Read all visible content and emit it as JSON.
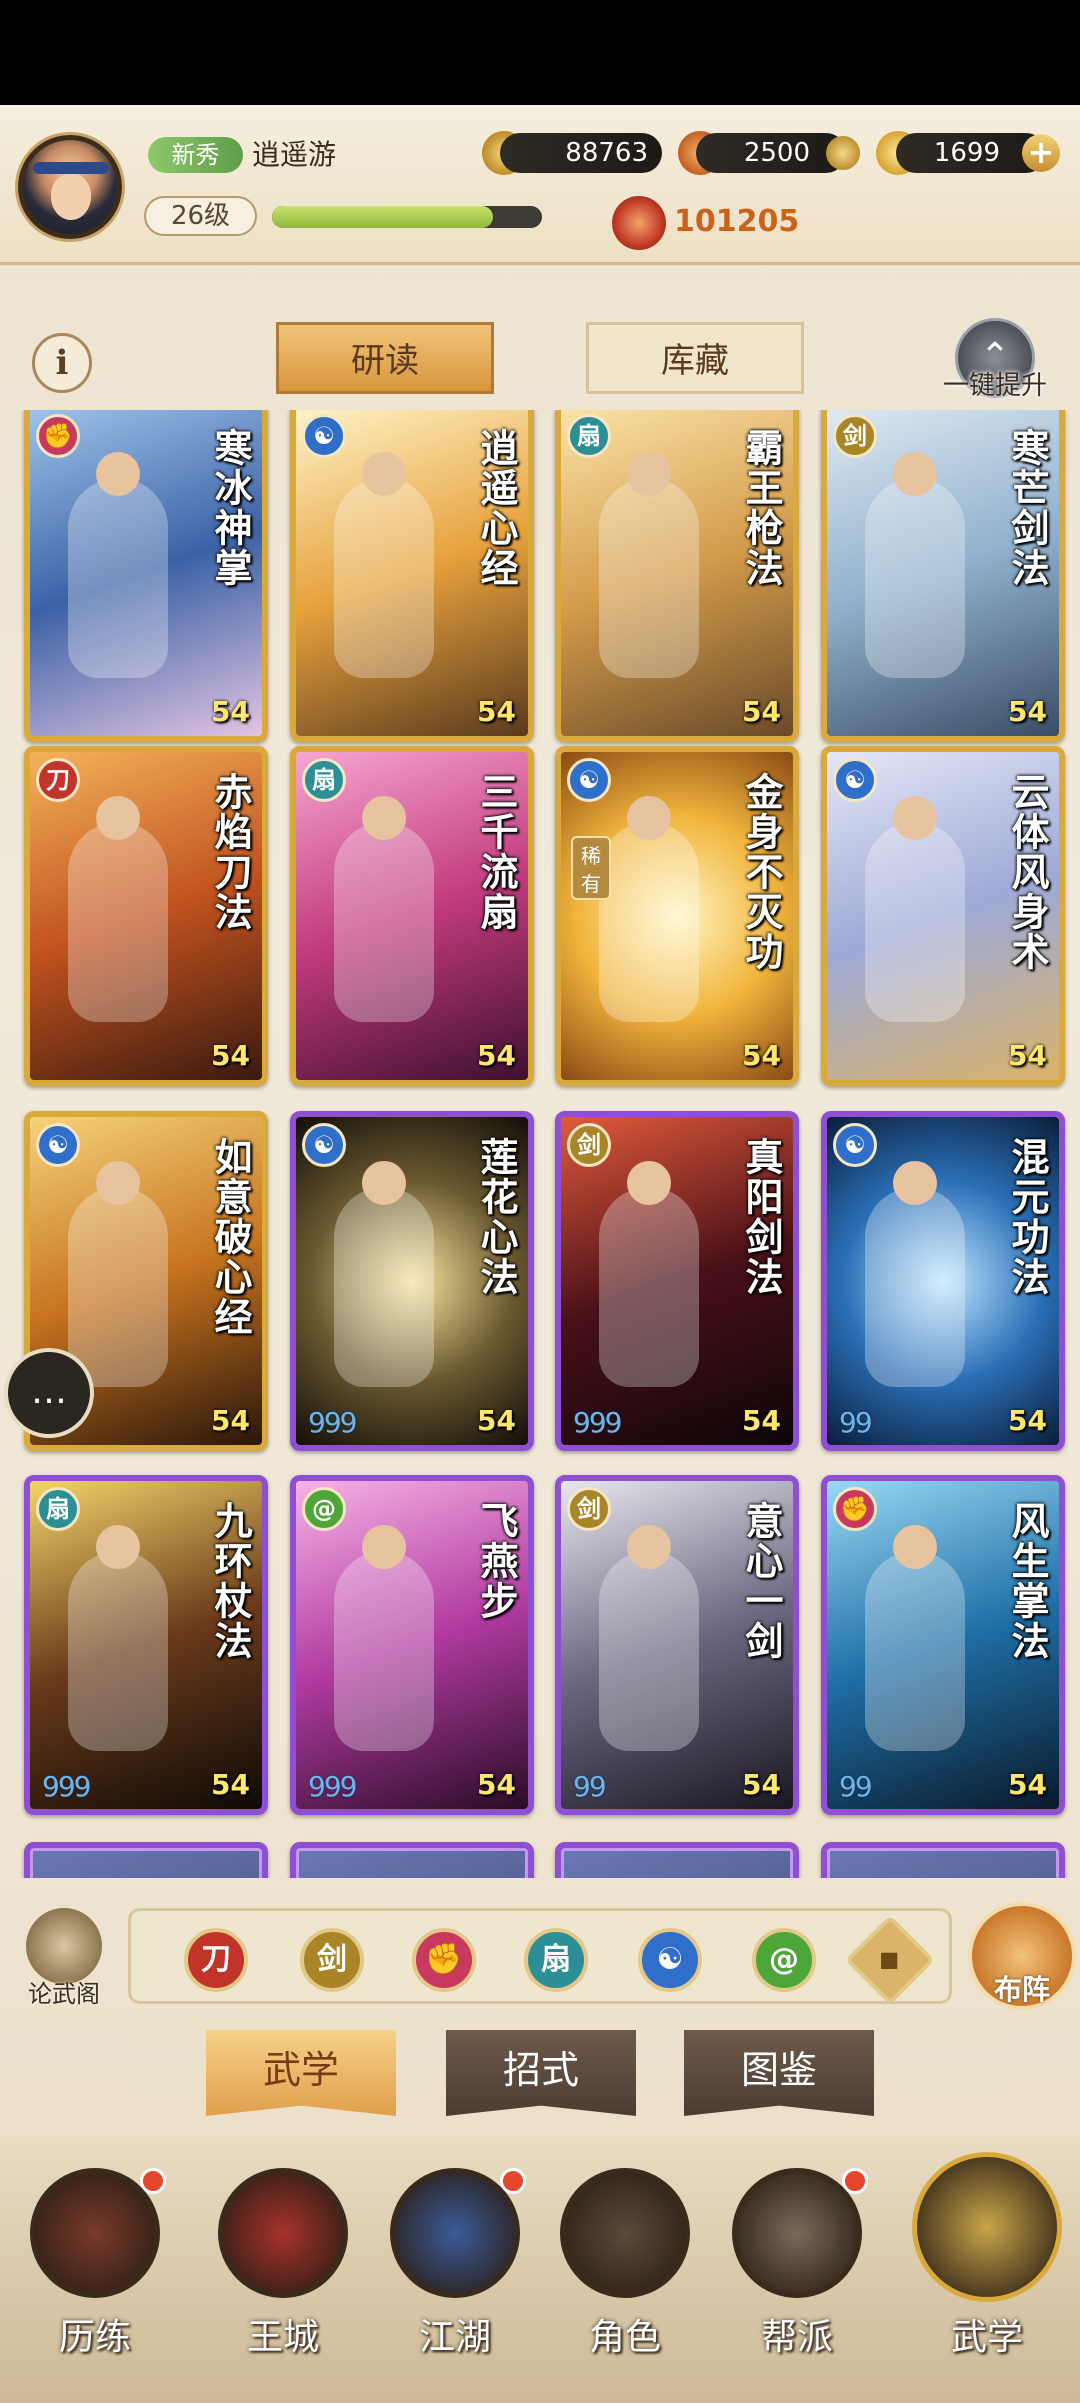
{
  "header": {
    "rank_badge": "新秀",
    "player_name": "逍遥游",
    "level": "26级",
    "exp_progress": 0.82,
    "coins": "88763",
    "jade": "2500",
    "gold": "1699",
    "power": "101205"
  },
  "tabs": {
    "read": "研读",
    "storage": "库藏",
    "upgrade_label": "一键提升"
  },
  "cards": [
    {
      "title": "寒冰神掌",
      "level": "54",
      "frame": "gold",
      "elem": "fist",
      "stars": ""
    },
    {
      "title": "逍遥心经",
      "level": "54",
      "frame": "gold",
      "elem": "yinyang",
      "stars": ""
    },
    {
      "title": "霸王枪法",
      "level": "54",
      "frame": "gold",
      "elem": "fan",
      "stars": ""
    },
    {
      "title": "寒芒剑法",
      "level": "54",
      "frame": "gold",
      "elem": "sword",
      "stars": ""
    },
    {
      "title": "赤焰刀法",
      "level": "54",
      "frame": "gold",
      "elem": "blade",
      "stars": ""
    },
    {
      "title": "三千流扇",
      "level": "54",
      "frame": "gold",
      "elem": "fan",
      "stars": ""
    },
    {
      "title": "金身不灭功",
      "level": "54",
      "frame": "gold",
      "elem": "yinyang",
      "stars": "",
      "rare": "稀有"
    },
    {
      "title": "云体风身术",
      "level": "54",
      "frame": "gold",
      "elem": "yinyang",
      "stars": ""
    },
    {
      "title": "如意破心经",
      "level": "54",
      "frame": "gold",
      "elem": "yinyang",
      "stars": ""
    },
    {
      "title": "莲花心法",
      "level": "54",
      "frame": "purple",
      "elem": "yinyang",
      "stars": "999"
    },
    {
      "title": "真阳剑法",
      "level": "54",
      "frame": "purple",
      "elem": "sword",
      "stars": "999"
    },
    {
      "title": "混元功法",
      "level": "54",
      "frame": "purple",
      "elem": "yinyang",
      "stars": "99"
    },
    {
      "title": "九环杖法",
      "level": "54",
      "frame": "purple",
      "elem": "fan",
      "stars": "999"
    },
    {
      "title": "飞燕步",
      "level": "54",
      "frame": "purple",
      "elem": "swirl",
      "stars": "999"
    },
    {
      "title": "意心一剑",
      "level": "54",
      "frame": "purple",
      "elem": "sword",
      "stars": "99"
    },
    {
      "title": "风生掌法",
      "level": "54",
      "frame": "purple",
      "elem": "fist",
      "stars": "99"
    }
  ],
  "filters": {
    "lunwu_label": "论武阁",
    "buzhen_label": "布阵",
    "elements": [
      "blade",
      "sword",
      "fist",
      "fan",
      "yinyang",
      "swirl",
      "diamond"
    ]
  },
  "subtabs": [
    "武学",
    "招式",
    "图鉴"
  ],
  "nav": [
    "历练",
    "王城",
    "江湖",
    "角色",
    "帮派",
    "武学"
  ],
  "colors": {
    "gold_frame": "#d9a93b",
    "purple_frame": "#8f4fd3",
    "level_text": "#ffe76b",
    "accent": "#d8953c"
  }
}
